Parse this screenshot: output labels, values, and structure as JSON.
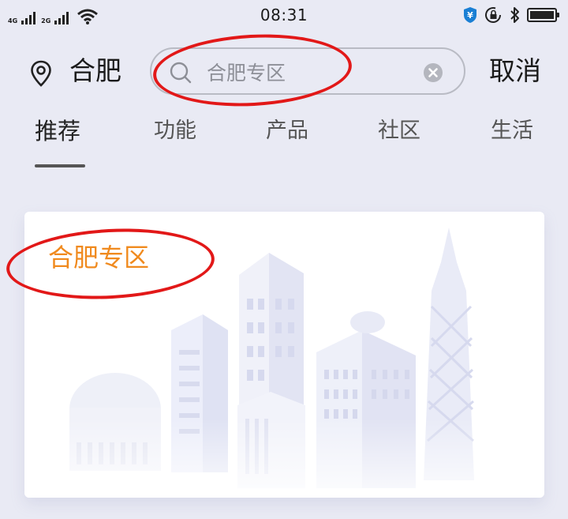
{
  "status_bar": {
    "network_1": "4G",
    "network_2": "2G",
    "time": "08:31",
    "icons": [
      "signal-icon",
      "wifi-icon",
      "payment-shield-icon",
      "lock-rotation-icon",
      "bluetooth-icon",
      "battery-icon"
    ]
  },
  "search_bar": {
    "location_icon": "location-pin-icon",
    "city": "合肥",
    "query": "合肥专区",
    "search_icon": "search-icon",
    "clear_icon": "clear-icon",
    "cancel_label": "取消"
  },
  "tabs": [
    {
      "label": "推荐",
      "active": true
    },
    {
      "label": "功能",
      "active": false
    },
    {
      "label": "产品",
      "active": false
    },
    {
      "label": "社区",
      "active": false
    },
    {
      "label": "生活",
      "active": false
    }
  ],
  "card": {
    "title": "合肥专区",
    "illustration": "city-skyline-illustration"
  },
  "colors": {
    "background": "#e9eaf4",
    "accent": "#f08a1e",
    "annotation": "#e21818"
  }
}
